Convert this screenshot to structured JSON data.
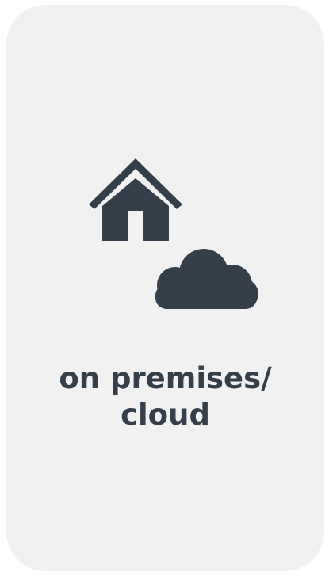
{
  "tile": {
    "label_line1": "on premises/",
    "label_line2": "cloud",
    "icons": [
      "house-icon",
      "cloud-icon"
    ],
    "colors": {
      "background": "#f1f1f2",
      "icon": "#353f4a",
      "text": "#353f4a"
    }
  }
}
